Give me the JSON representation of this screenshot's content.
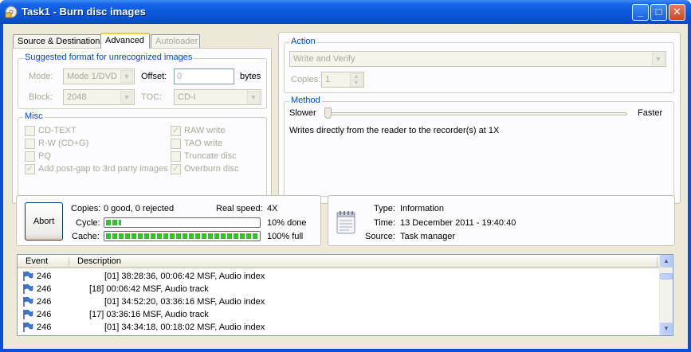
{
  "window": {
    "title": "Task1 - Burn disc images",
    "minimize": "_",
    "maximize": "□",
    "close": "✕"
  },
  "tabs": {
    "items": [
      {
        "label": "Source & Destination"
      },
      {
        "label": "Advanced"
      },
      {
        "label": "Autoloader"
      }
    ]
  },
  "format": {
    "group_label": "Suggested format for unrecognized images",
    "mode_label": "Mode:",
    "mode_value": "Mode 1/DVD",
    "offset_label": "Offset:",
    "offset_value": "0",
    "offset_unit": "bytes",
    "block_label": "Block:",
    "block_value": "2048",
    "toc_label": "TOC:",
    "toc_value": "CD-I"
  },
  "misc": {
    "group_label": "Misc",
    "options": [
      {
        "label": "CD-TEXT",
        "checked": false
      },
      {
        "label": "R-W (CD+G)",
        "checked": false
      },
      {
        "label": "PQ",
        "checked": false
      },
      {
        "label": "Add post-gap to 3rd party images",
        "checked": true
      },
      {
        "label": "RAW write",
        "checked": true
      },
      {
        "label": "TAO write",
        "checked": false
      },
      {
        "label": "Truncate disc",
        "checked": false
      },
      {
        "label": "Overburn disc",
        "checked": true
      }
    ],
    "check_mark": "✓"
  },
  "action": {
    "group_label": "Action",
    "value": "Write and Verify",
    "copies_label": "Copies:",
    "copies_value": "1"
  },
  "method": {
    "group_label": "Method",
    "slower_label": "Slower",
    "faster_label": "Faster",
    "slider_position": 0,
    "description": "Writes directly from the reader to the recorder(s) at 1X"
  },
  "status": {
    "abort_label": "Abort",
    "copies_label": "Copies:",
    "copies_value": "0 good, 0 rejected",
    "real_speed_label": "Real speed:",
    "real_speed_value": "4X",
    "cycle_label": "Cycle:",
    "cycle_percent": 10,
    "cycle_text": "10% done",
    "cache_label": "Cache:",
    "cache_percent": 100,
    "cache_text": "100% full"
  },
  "info": {
    "type_label": "Type:",
    "type_value": "Information",
    "time_label": "Time:",
    "time_value": "13 December 2011 - 19:40:40",
    "source_label": "Source:",
    "source_value": "Task manager"
  },
  "log": {
    "col_event": "Event",
    "col_description": "Description",
    "rows": [
      {
        "event": "246",
        "description": "[01] 38:28:36, 00:06:42 MSF, Audio index",
        "indent": 1
      },
      {
        "event": "246",
        "description": "[18] 00:06:42 MSF, Audio track",
        "indent": 0
      },
      {
        "event": "246",
        "description": "[01] 34:52:20, 03:36:16 MSF, Audio index",
        "indent": 1
      },
      {
        "event": "246",
        "description": "[17] 03:36:16 MSF, Audio track",
        "indent": 0
      },
      {
        "event": "246",
        "description": "[01] 34:34:18, 00:18:02 MSF, Audio index",
        "indent": 1
      }
    ]
  },
  "colors": {
    "titlebar": "#0a4fd6",
    "progress": "#2fc22f",
    "group_label": "#0046d5",
    "flag": "#3a7bd5"
  }
}
